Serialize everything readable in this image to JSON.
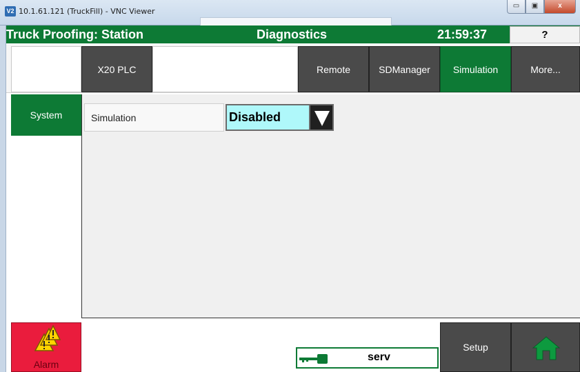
{
  "window": {
    "icon_text": "V2",
    "title": "10.1.61.121 (TruckFill) - VNC Viewer",
    "minimize_glyph": "▭",
    "maximize_glyph": "▣",
    "close_glyph": "x"
  },
  "header": {
    "station": "Truck Proofing: Station",
    "section": "Diagnostics",
    "time": "21:59:37",
    "help_label": "?"
  },
  "tabs": [
    {
      "label": "X20 PLC",
      "active": false
    },
    {
      "label": "Remote",
      "active": false
    },
    {
      "label": "SDManager",
      "active": false
    },
    {
      "label": "Simulation",
      "active": true
    },
    {
      "label": "More...",
      "active": false
    }
  ],
  "sidebar": {
    "items": [
      {
        "label": "System",
        "active": true
      }
    ]
  },
  "main": {
    "field_label": "Simulation",
    "field_value": "Disabled"
  },
  "footer": {
    "alarm_label": "Alarm",
    "status_text": "serv",
    "setup_label": "Setup"
  },
  "colors": {
    "accent_green": "#0d7a35",
    "dark_button": "#4a4a4a",
    "alarm_red": "#ea1c3d",
    "dropdown_cyan": "#aff8fa"
  },
  "icons": {
    "alarm": "warning-triangles-icon",
    "key": "key-icon",
    "home": "home-icon",
    "dropdown": "triangle-down-icon"
  }
}
